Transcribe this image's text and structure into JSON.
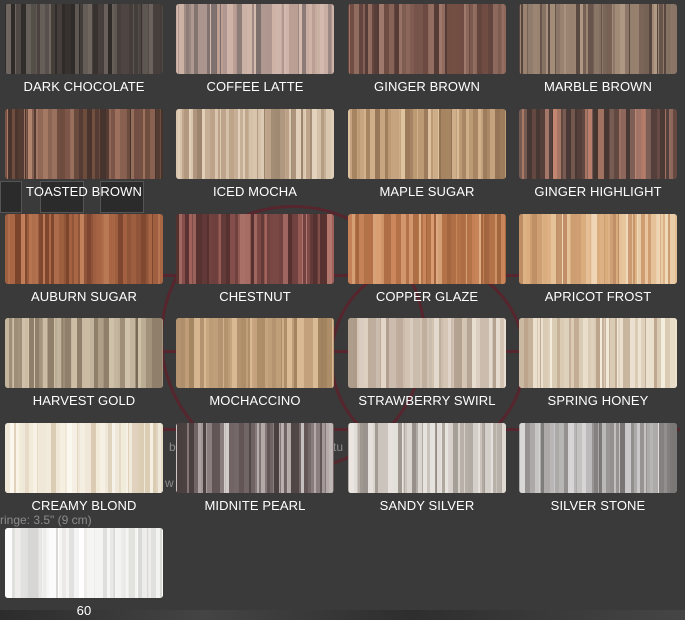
{
  "background": {
    "fringe_text": "ringe: 3.5\" (9 cm)",
    "fragment_b": "b",
    "fragment_tu": "tu",
    "fragment_w": "w"
  },
  "swatches": [
    {
      "label": "DARK CHOCOLATE",
      "colors": [
        "#2b2624",
        "#3c3430",
        "#4a403c",
        "#5b524d",
        "#221e1c",
        "#6a605a"
      ]
    },
    {
      "label": "COFFEE LATTE",
      "colors": [
        "#b89a8e",
        "#8d7a76",
        "#c8aca0",
        "#6e615f",
        "#a58e87",
        "#d3b7aa"
      ]
    },
    {
      "label": "GINGER BROWN",
      "colors": [
        "#5a3a32",
        "#7a5448",
        "#8f6658",
        "#4a2f2a",
        "#6b4338",
        "#9b7263"
      ]
    },
    {
      "label": "MARBLE BROWN",
      "colors": [
        "#5e4a40",
        "#8a7463",
        "#b0977f",
        "#4b3a33",
        "#725c4e",
        "#9f8670"
      ]
    },
    {
      "label": "TOASTED BROWN",
      "colors": [
        "#4a3028",
        "#7a5040",
        "#9a6a55",
        "#3a2620",
        "#6a4535",
        "#b07e66"
      ]
    },
    {
      "label": "ICED MOCHA",
      "colors": [
        "#c2aa90",
        "#a88d72",
        "#d8c4aa",
        "#8e755d",
        "#b89c80",
        "#e2d0b8"
      ]
    },
    {
      "label": "MAPLE SUGAR",
      "colors": [
        "#b8946c",
        "#d2b088",
        "#a07c58",
        "#e0c49e",
        "#c4a07a",
        "#8c6a4a"
      ]
    },
    {
      "label": "GINGER HIGHLIGHT",
      "colors": [
        "#4a3430",
        "#7a5a50",
        "#a07060",
        "#3a2a26",
        "#c08068",
        "#5e4038"
      ]
    },
    {
      "label": "AUBURN SUGAR",
      "colors": [
        "#8a4a2e",
        "#a8603c",
        "#c07a52",
        "#72391f",
        "#b36d46",
        "#9a5636"
      ]
    },
    {
      "label": "CHESTNUT",
      "colors": [
        "#5a2e2c",
        "#7e4440",
        "#9c5a52",
        "#4a2422",
        "#b07066",
        "#6a3834"
      ]
    },
    {
      "label": "COPPER GLAZE",
      "colors": [
        "#b06a3e",
        "#c88052",
        "#d89a6c",
        "#9a5a32",
        "#e0ac80",
        "#a8643a"
      ]
    },
    {
      "label": "APRICOT FROST",
      "colors": [
        "#d8a878",
        "#e8c49a",
        "#c89468",
        "#f0d8b8",
        "#dcb080",
        "#b8845a"
      ]
    },
    {
      "label": "HARVEST GOLD",
      "colors": [
        "#8a7862",
        "#b0a088",
        "#cdbea4",
        "#6e5e4a",
        "#a08e76",
        "#d8c8ae"
      ]
    },
    {
      "label": "MOCHACCINO",
      "colors": [
        "#b08e68",
        "#c8a47c",
        "#9a7a56",
        "#d8b890",
        "#a88660",
        "#bc9a72"
      ]
    },
    {
      "label": "STRAWBERRY SWIRL",
      "colors": [
        "#c8b8a8",
        "#dccfc0",
        "#b8a492",
        "#e8ddd0",
        "#a89482",
        "#d2c2b0"
      ]
    },
    {
      "label": "SPRING HONEY",
      "colors": [
        "#d8c8b0",
        "#ebe0cc",
        "#c4b098",
        "#f4ecdc",
        "#b89e84",
        "#e0d2bc"
      ]
    },
    {
      "label": "CREAMY BLOND",
      "colors": [
        "#efe6d6",
        "#f8f2e6",
        "#e2d4bc",
        "#fbf8f0",
        "#d8c8ae",
        "#f2ead8"
      ]
    },
    {
      "label": "MIDNITE PEARL",
      "colors": [
        "#5a4c4c",
        "#8a7c7c",
        "#b4aaa8",
        "#3e3434",
        "#d8d2d0",
        "#6e6060"
      ]
    },
    {
      "label": "SANDY SILVER",
      "colors": [
        "#c8c0b8",
        "#e0dbd6",
        "#aaa29a",
        "#ece8e4",
        "#8e8680",
        "#d6d0ca"
      ]
    },
    {
      "label": "SILVER STONE",
      "colors": [
        "#a8a4a4",
        "#c8c6c6",
        "#8a8686",
        "#dedcdc",
        "#6e6a6a",
        "#b8b6b6"
      ]
    },
    {
      "label": "60",
      "colors": [
        "#ecebea",
        "#f6f6f5",
        "#dcdcda",
        "#ffffff",
        "#d0d0ce",
        "#e6e6e4"
      ]
    }
  ]
}
